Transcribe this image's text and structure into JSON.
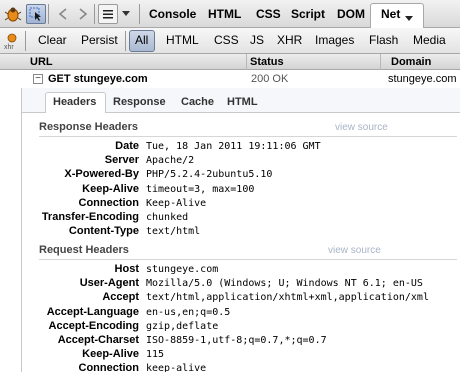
{
  "toolbar": {
    "tabs": [
      "Console",
      "HTML",
      "CSS",
      "Script",
      "DOM",
      "Net"
    ],
    "active_tab": "Net"
  },
  "filter_bar": {
    "clear": "Clear",
    "persist": "Persist",
    "filters": [
      "All",
      "HTML",
      "CSS",
      "JS",
      "XHR",
      "Images",
      "Flash",
      "Media"
    ],
    "active_filter": "All"
  },
  "columns": {
    "url": "URL",
    "status": "Status",
    "domain": "Domain"
  },
  "request": {
    "toggle": "−",
    "label": "GET stungeye.com",
    "status": "200 OK",
    "domain": "stungeye.com"
  },
  "subtabs": [
    "Headers",
    "Response",
    "Cache",
    "HTML"
  ],
  "active_subtab": "Headers",
  "response_headers": {
    "title": "Response Headers",
    "view_source": "view source",
    "rows": [
      {
        "name": "Date",
        "value": "Tue, 18 Jan 2011 19:11:06 GMT"
      },
      {
        "name": "Server",
        "value": "Apache/2"
      },
      {
        "name": "X-Powered-By",
        "value": "PHP/5.2.4-2ubuntu5.10"
      },
      {
        "name": "Keep-Alive",
        "value": "timeout=3, max=100"
      },
      {
        "name": "Connection",
        "value": "Keep-Alive"
      },
      {
        "name": "Transfer-Encoding",
        "value": "chunked"
      },
      {
        "name": "Content-Type",
        "value": "text/html"
      }
    ]
  },
  "request_headers": {
    "title": "Request Headers",
    "view_source": "view source",
    "rows": [
      {
        "name": "Host",
        "value": "stungeye.com"
      },
      {
        "name": "User-Agent",
        "value": "Mozilla/5.0 (Windows; U; Windows NT 6.1; en-US"
      },
      {
        "name": "Accept",
        "value": "text/html,application/xhtml+xml,application/xml"
      },
      {
        "name": "Accept-Language",
        "value": "en-us,en;q=0.5"
      },
      {
        "name": "Accept-Encoding",
        "value": "gzip,deflate"
      },
      {
        "name": "Accept-Charset",
        "value": "ISO-8859-1,utf-8;q=0.7,*;q=0.7"
      },
      {
        "name": "Keep-Alive",
        "value": "115"
      },
      {
        "name": "Connection",
        "value": "keep-alive"
      }
    ]
  },
  "icons": {
    "firebug": "firebug-icon",
    "inspect": "inspect-icon",
    "back": "back-icon",
    "forward": "forward-icon",
    "menu": "menu-icon",
    "dropdown": "chevron-down-icon",
    "xhr_badge": "xhr"
  },
  "colors": {
    "accent_blue": "#3c6ec8",
    "view_source": "#a8b4c8",
    "status_text": "#555555"
  }
}
